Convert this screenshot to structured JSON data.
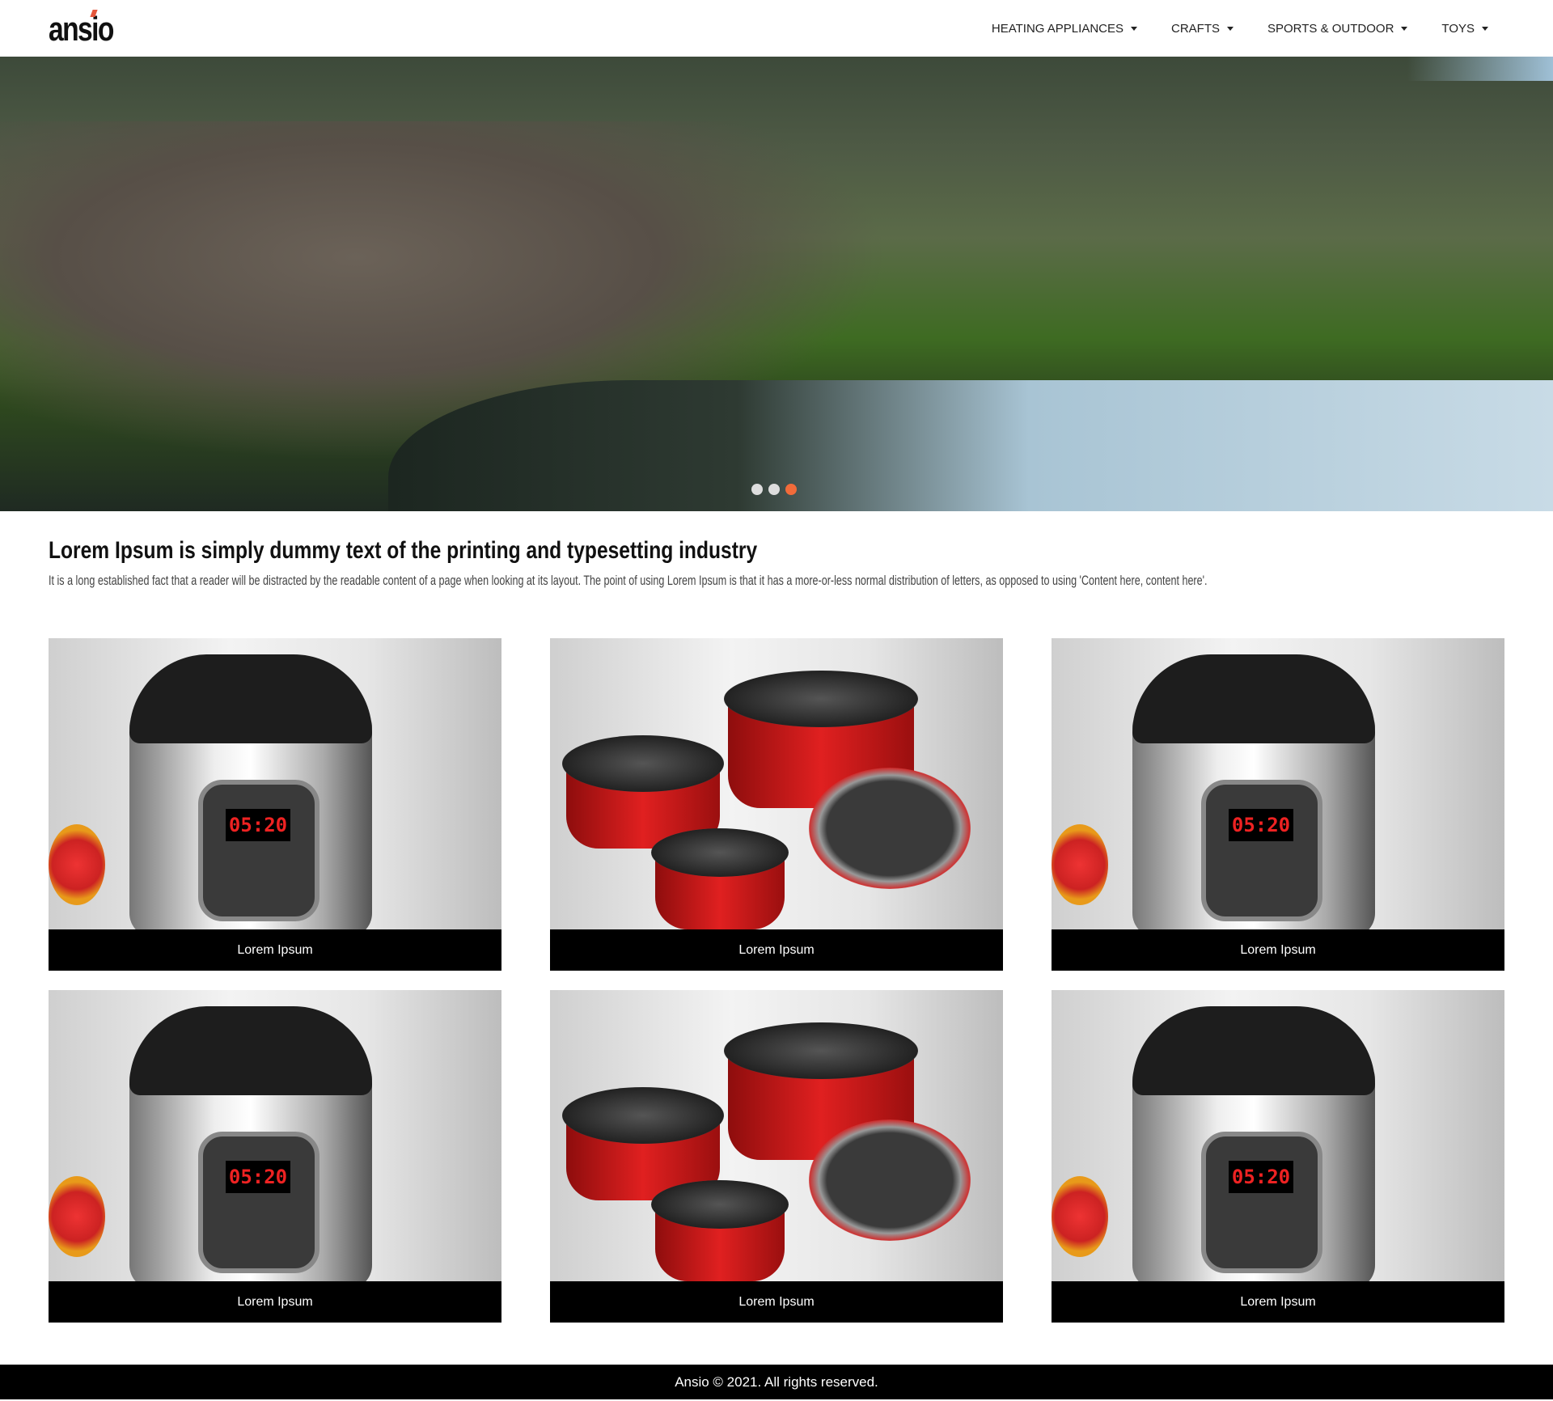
{
  "header": {
    "logo": "ansio",
    "nav": [
      {
        "label": "HEATING APPLIANCES"
      },
      {
        "label": "CRAFTS"
      },
      {
        "label": "SPORTS & OUTDOOR"
      },
      {
        "label": "TOYS"
      }
    ]
  },
  "hero": {
    "slides": 3,
    "active_slide": 3,
    "accent_color": "#f26b3a"
  },
  "intro": {
    "title": "Lorem Ipsum is simply dummy text of the printing and typesetting industry",
    "text": "It is a long established fact that a reader will be distracted by the readable content of a page when looking at its layout. The point of using Lorem Ipsum is that it has a more-or-less normal distribution of letters, as opposed to using 'Content here, content here'."
  },
  "products": [
    {
      "caption": "Lorem Ipsum",
      "image": "pressure-cooker",
      "display": "05:20"
    },
    {
      "caption": "Lorem Ipsum",
      "image": "cookware-set"
    },
    {
      "caption": "Lorem Ipsum",
      "image": "pressure-cooker",
      "display": "05:20"
    },
    {
      "caption": "Lorem Ipsum",
      "image": "pressure-cooker",
      "display": "05:20"
    },
    {
      "caption": "Lorem Ipsum",
      "image": "cookware-set"
    },
    {
      "caption": "Lorem Ipsum",
      "image": "pressure-cooker",
      "display": "05:20"
    }
  ],
  "footer": {
    "text": "Ansio © 2021. All rights reserved."
  }
}
